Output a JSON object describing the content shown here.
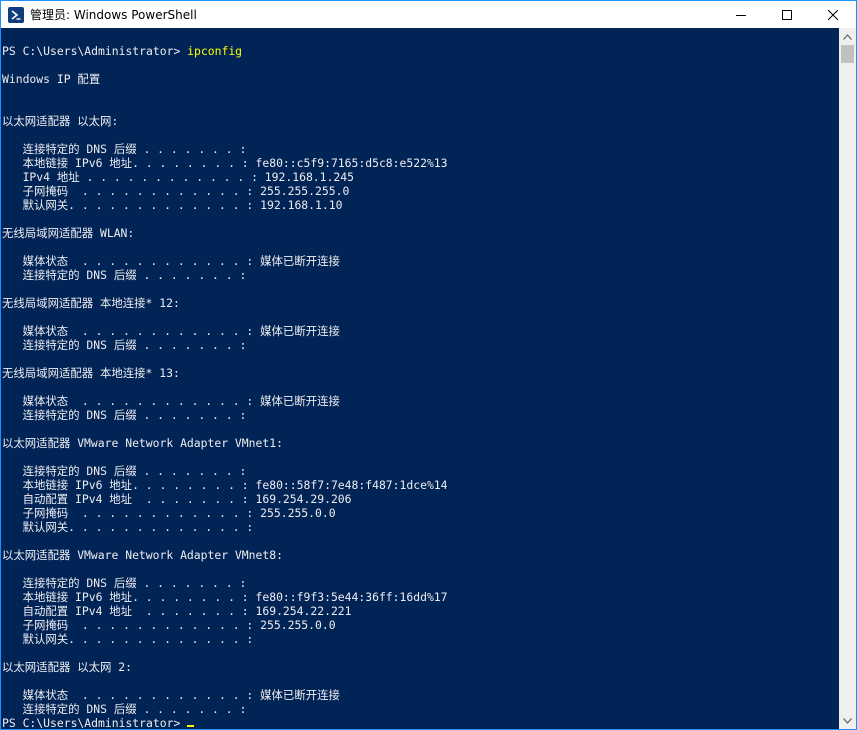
{
  "window": {
    "title": "管理员: Windows PowerShell"
  },
  "icons": {
    "app": "powershell-icon",
    "minimize": "minimize-icon",
    "maximize": "maximize-icon",
    "close": "close-icon",
    "scroll_up": "chevron-up-icon",
    "scroll_down": "chevron-down-icon"
  },
  "colors": {
    "console_background": "#012456",
    "console_text": "#eeedf0",
    "command_text": "#ffff00"
  },
  "terminal": {
    "prompt": "PS C:\\Users\\Administrator> ",
    "command": "ipconfig",
    "output": "\nWindows IP 配置\n\n\n以太网适配器 以太网:\n\n   连接特定的 DNS 后缀 . . . . . . . :\n   本地链接 IPv6 地址. . . . . . . . : fe80::c5f9:7165:d5c8:e522%13\n   IPv4 地址 . . . . . . . . . . . . : 192.168.1.245\n   子网掩码  . . . . . . . . . . . . : 255.255.255.0\n   默认网关. . . . . . . . . . . . . : 192.168.1.10\n\n无线局域网适配器 WLAN:\n\n   媒体状态  . . . . . . . . . . . . : 媒体已断开连接\n   连接特定的 DNS 后缀 . . . . . . . :\n\n无线局域网适配器 本地连接* 12:\n\n   媒体状态  . . . . . . . . . . . . : 媒体已断开连接\n   连接特定的 DNS 后缀 . . . . . . . :\n\n无线局域网适配器 本地连接* 13:\n\n   媒体状态  . . . . . . . . . . . . : 媒体已断开连接\n   连接特定的 DNS 后缀 . . . . . . . :\n\n以太网适配器 VMware Network Adapter VMnet1:\n\n   连接特定的 DNS 后缀 . . . . . . . :\n   本地链接 IPv6 地址. . . . . . . . : fe80::58f7:7e48:f487:1dce%14\n   自动配置 IPv4 地址  . . . . . . . : 169.254.29.206\n   子网掩码  . . . . . . . . . . . . : 255.255.0.0\n   默认网关. . . . . . . . . . . . . :\n\n以太网适配器 VMware Network Adapter VMnet8:\n\n   连接特定的 DNS 后缀 . . . . . . . :\n   本地链接 IPv6 地址. . . . . . . . : fe80::f9f3:5e44:36ff:16dd%17\n   自动配置 IPv4 地址  . . . . . . . : 169.254.22.221\n   子网掩码  . . . . . . . . . . . . : 255.255.0.0\n   默认网关. . . . . . . . . . . . . :\n\n以太网适配器 以太网 2:\n\n   媒体状态  . . . . . . . . . . . . : 媒体已断开连接\n   连接特定的 DNS 后缀 . . . . . . . :\n",
    "final_prompt": "PS C:\\Users\\Administrator> "
  }
}
